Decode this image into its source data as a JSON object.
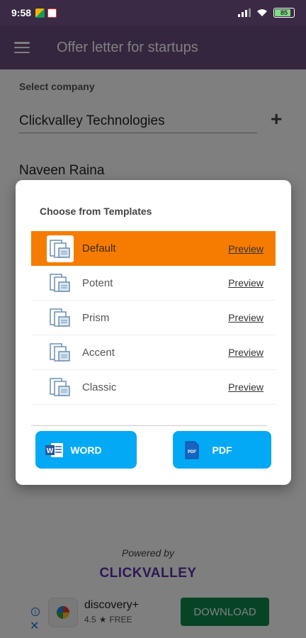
{
  "status_bar": {
    "time": "9:58",
    "battery": "85"
  },
  "app_bar": {
    "title": "Offer letter for startups"
  },
  "form": {
    "select_company_label": "Select company",
    "company_value": "Clickvalley Technologies",
    "employee_name": "Naveen Raina"
  },
  "dialog": {
    "title": "Choose from Templates",
    "preview_label": "Preview",
    "templates": [
      {
        "name": "Default",
        "selected": true
      },
      {
        "name": "Potent",
        "selected": false
      },
      {
        "name": "Prism",
        "selected": false
      },
      {
        "name": "Accent",
        "selected": false
      },
      {
        "name": "Classic",
        "selected": false
      }
    ],
    "word_button": "WORD",
    "pdf_button": "PDF"
  },
  "footer": {
    "powered_by": "Powered by",
    "brand": "CLICKVALLEY"
  },
  "ad": {
    "title": "discovery+",
    "rating": "4.5",
    "price": "FREE",
    "cta": "DOWNLOAD"
  },
  "colors": {
    "app_bar": "#6a4d7f",
    "selected_row": "#f57c00",
    "button": "#03a9f4",
    "brand": "#5a2fa8",
    "ad_cta": "#0b8a4a"
  }
}
